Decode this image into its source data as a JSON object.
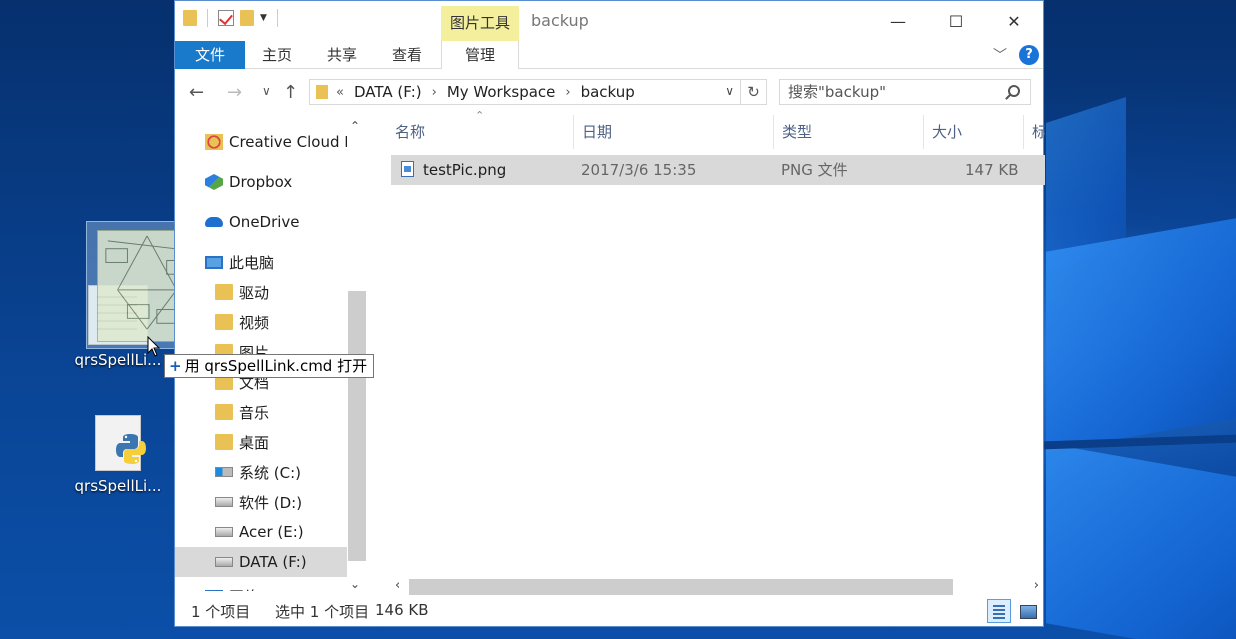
{
  "desktop": {
    "icons": [
      {
        "label": "qrsSpellLi..."
      },
      {
        "label": "qrsSpellLi..."
      }
    ],
    "drag_tooltip": {
      "plus": "+",
      "text": "用 qrsSpellLink.cmd 打开"
    }
  },
  "window": {
    "title": "backup",
    "context_tab_header": "图片工具",
    "controls": {
      "minimize": "—",
      "maximize": "☐",
      "close": "✕"
    },
    "ribbon": {
      "tabs": [
        "文件",
        "主页",
        "共享",
        "查看",
        "管理"
      ],
      "collapse_icon": "chevron-down-icon",
      "help": "?"
    },
    "address": {
      "prefix": "«",
      "crumbs": [
        "DATA (F:)",
        "My Workspace",
        "backup"
      ],
      "separator": "›"
    },
    "search": {
      "placeholder": "搜索\"backup\""
    },
    "nav_pane": [
      {
        "label": "Creative Cloud F",
        "icon": "creative-cloud-icon"
      },
      {
        "label": "Dropbox",
        "icon": "dropbox-icon"
      },
      {
        "label": "OneDrive",
        "icon": "onedrive-icon"
      },
      {
        "label": "此电脑",
        "icon": "pc-icon"
      },
      {
        "label": "驱动",
        "icon": "folder-icon"
      },
      {
        "label": "视频",
        "icon": "folder-icon"
      },
      {
        "label": "图片",
        "icon": "folder-icon"
      },
      {
        "label": "文档",
        "icon": "folder-icon"
      },
      {
        "label": "音乐",
        "icon": "folder-icon"
      },
      {
        "label": "桌面",
        "icon": "folder-icon"
      },
      {
        "label": "系统 (C:)",
        "icon": "drive-icon"
      },
      {
        "label": "软件 (D:)",
        "icon": "drive-icon"
      },
      {
        "label": "Acer (E:)",
        "icon": "drive-icon"
      },
      {
        "label": "DATA (F:)",
        "icon": "drive-icon",
        "selected": true
      },
      {
        "label": "网络",
        "icon": "network-icon"
      }
    ],
    "columns": [
      "名称",
      "日期",
      "类型",
      "大小",
      "标"
    ],
    "files": [
      {
        "name": "testPic.png",
        "date": "2017/3/6 15:35",
        "type": "PNG 文件",
        "size": "147 KB"
      }
    ],
    "status": {
      "count": "1 个项目",
      "selected": "选中 1 个项目",
      "size": "146 KB"
    }
  }
}
